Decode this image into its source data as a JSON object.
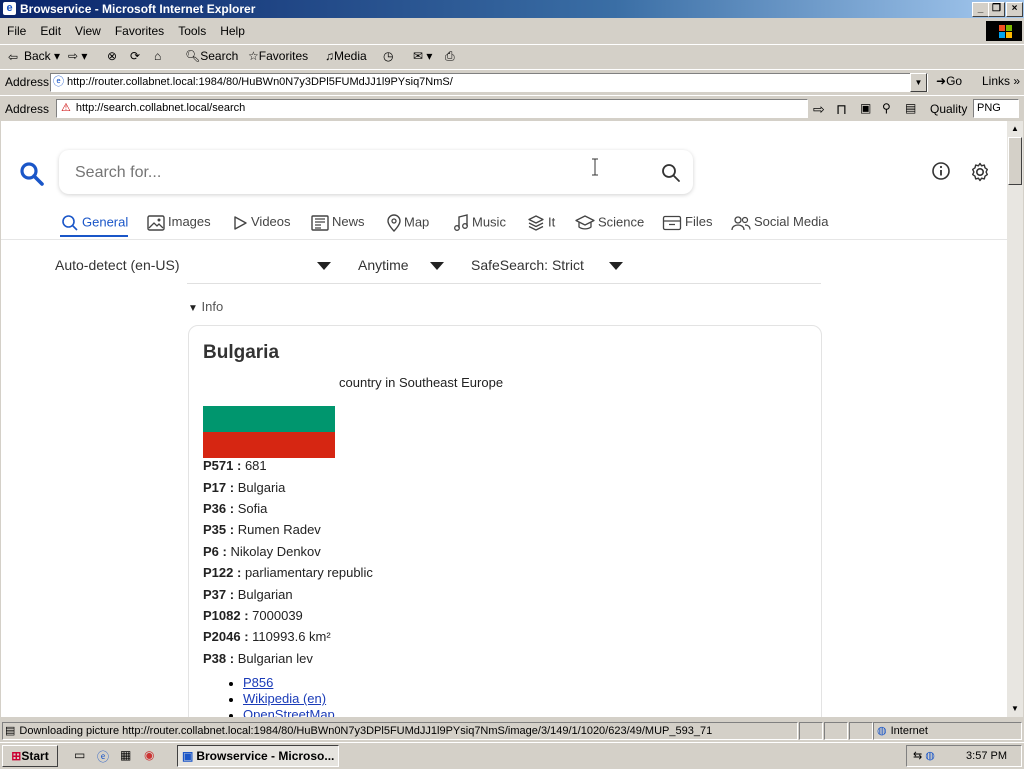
{
  "window": {
    "title": "Browservice - Microsoft Internet Explorer"
  },
  "menu": [
    "File",
    "Edit",
    "View",
    "Favorites",
    "Tools",
    "Help"
  ],
  "toolbar": {
    "back": "Back",
    "search": "Search",
    "favorites": "Favorites",
    "media": "Media"
  },
  "ie_address": {
    "label": "Address",
    "url": "http://router.collabnet.local:1984/80/HuBWn0N7y3DPl5FUMdJJ1l9PYsiq7NmS/",
    "go": "Go",
    "links": "Links"
  },
  "bs_address": {
    "label": "Address",
    "url": "http://search.collabnet.local/search",
    "quality_label": "Quality",
    "quality_value": "PNG"
  },
  "search": {
    "placeholder": "Search for..."
  },
  "categories": [
    "General",
    "Images",
    "Videos",
    "News",
    "Map",
    "Music",
    "It",
    "Science",
    "Files",
    "Social Media"
  ],
  "filters": {
    "language": "Auto-detect (en-US)",
    "time": "Anytime",
    "safesearch": "SafeSearch: Strict"
  },
  "info": {
    "toggle": "Info",
    "title": "Bulgaria",
    "description": "country in Southeast Europe",
    "flag_colors": [
      "#ffffff",
      "#00966e",
      "#d62612"
    ],
    "properties": [
      {
        "key": "P571 :",
        "value": "681"
      },
      {
        "key": "P17 :",
        "value": "Bulgaria"
      },
      {
        "key": "P36 :",
        "value": "Sofia"
      },
      {
        "key": "P35 :",
        "value": "Rumen Radev"
      },
      {
        "key": "P6 :",
        "value": "Nikolay Denkov"
      },
      {
        "key": "P122 :",
        "value": "parliamentary republic"
      },
      {
        "key": "P37 :",
        "value": "Bulgarian"
      },
      {
        "key": "P1082 :",
        "value": "7000039"
      },
      {
        "key": "P2046 :",
        "value": "110993.6 km²"
      },
      {
        "key": "P38 :",
        "value": "Bulgarian lev"
      }
    ],
    "links": [
      "P856",
      "Wikipedia (en)",
      "OpenStreetMap"
    ]
  },
  "status": {
    "text": "Downloading picture http://router.collabnet.local:1984/80/HuBWn0N7y3DPl5FUMdJJ1l9PYsiq7NmS/image/3/149/1/1020/623/49/MUP_593_71",
    "zone": "Internet"
  },
  "taskbar": {
    "start": "Start",
    "task": "Browservice - Microso...",
    "clock": "3:57 PM"
  },
  "colors": {
    "accent": "#1a56c8",
    "link": "#1a3bb8"
  }
}
